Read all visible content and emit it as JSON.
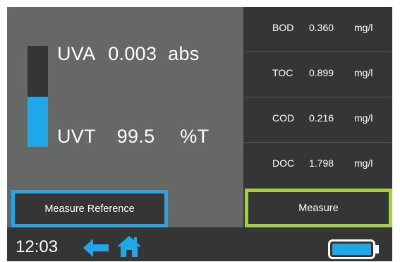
{
  "colors": {
    "accent_blue": "#1ea7ea",
    "accent_green": "#9fd432",
    "panel_gray": "#666866",
    "dark": "#353535"
  },
  "readings": {
    "uva_label": "UVA",
    "uva_value": "0.003",
    "uva_unit": "abs",
    "uvt_label": "UVT",
    "uvt_value": "99.5",
    "uvt_unit": "%T",
    "uvt_level_fraction": 0.5
  },
  "parameters": [
    {
      "name": "BOD",
      "value": "0.360",
      "unit": "mg/l"
    },
    {
      "name": "TOC",
      "value": "0.899",
      "unit": "mg/l"
    },
    {
      "name": "COD",
      "value": "0.216",
      "unit": "mg/l"
    },
    {
      "name": "DOC",
      "value": "1.798",
      "unit": "mg/l"
    }
  ],
  "buttons": {
    "measure_reference": "Measure Reference",
    "measure": "Measure"
  },
  "status_bar": {
    "time": "12:03",
    "back_icon": "arrow-left-icon",
    "home_icon": "home-icon",
    "battery_icon": "battery-icon",
    "battery_level_fraction": 1.0
  }
}
